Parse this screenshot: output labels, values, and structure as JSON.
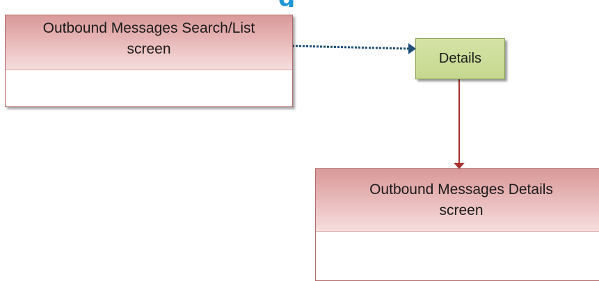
{
  "title_fragment": "g",
  "nodes": {
    "search_list": {
      "label_line1": "Outbound Messages Search/List",
      "label_line2": "screen"
    },
    "details_action": {
      "label": "Details"
    },
    "details_screen": {
      "label_line1": "Outbound Messages Details",
      "label_line2": "screen"
    }
  },
  "colors": {
    "screen_box_header": "#e6b3b3",
    "screen_box_border": "#b06a6a",
    "action_box_fill": "#c9db96",
    "dotted_arrow": "#1f4e79",
    "solid_arrow": "#a83232",
    "title": "#1f97d6"
  }
}
